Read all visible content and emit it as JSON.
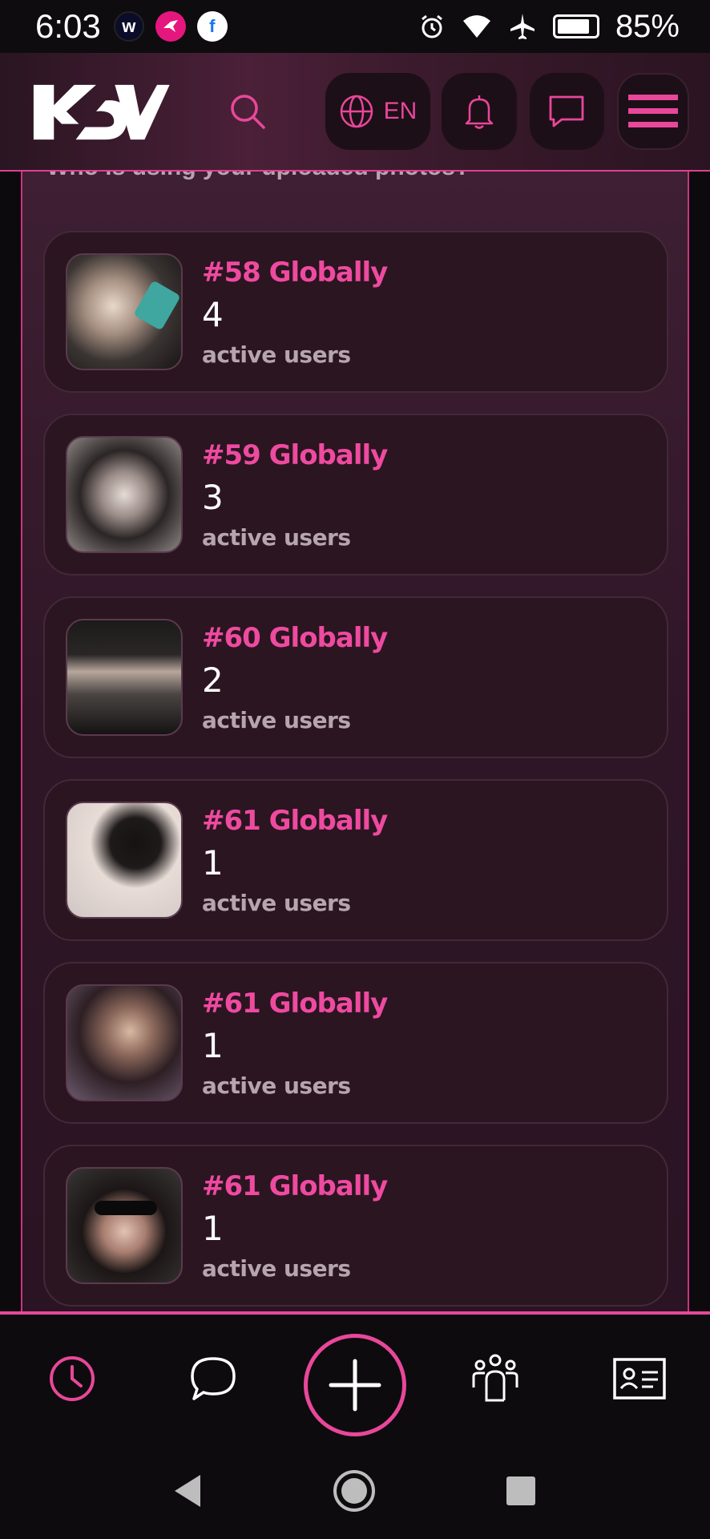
{
  "status_bar": {
    "time": "6:03",
    "apps": [
      "w",
      "bird-app",
      "f"
    ],
    "battery_percent": "85%",
    "battery_level": 0.85
  },
  "header": {
    "logo_text": "KV",
    "language": "EN",
    "accent_color": "#e8479a"
  },
  "panel": {
    "cut_text": "Who is using your uploaded photos?"
  },
  "cards": [
    {
      "rank": "#58 Globally",
      "count": "4",
      "label": "active users"
    },
    {
      "rank": "#59 Globally",
      "count": "3",
      "label": "active users"
    },
    {
      "rank": "#60 Globally",
      "count": "2",
      "label": "active users"
    },
    {
      "rank": "#61 Globally",
      "count": "1",
      "label": "active users"
    },
    {
      "rank": "#61 Globally",
      "count": "1",
      "label": "active users"
    },
    {
      "rank": "#61 Globally",
      "count": "1",
      "label": "active users"
    }
  ],
  "bottom_nav": {
    "items": [
      "clock-icon",
      "chat-bubble-icon",
      "add-icon",
      "people-icon",
      "id-card-icon"
    ]
  }
}
